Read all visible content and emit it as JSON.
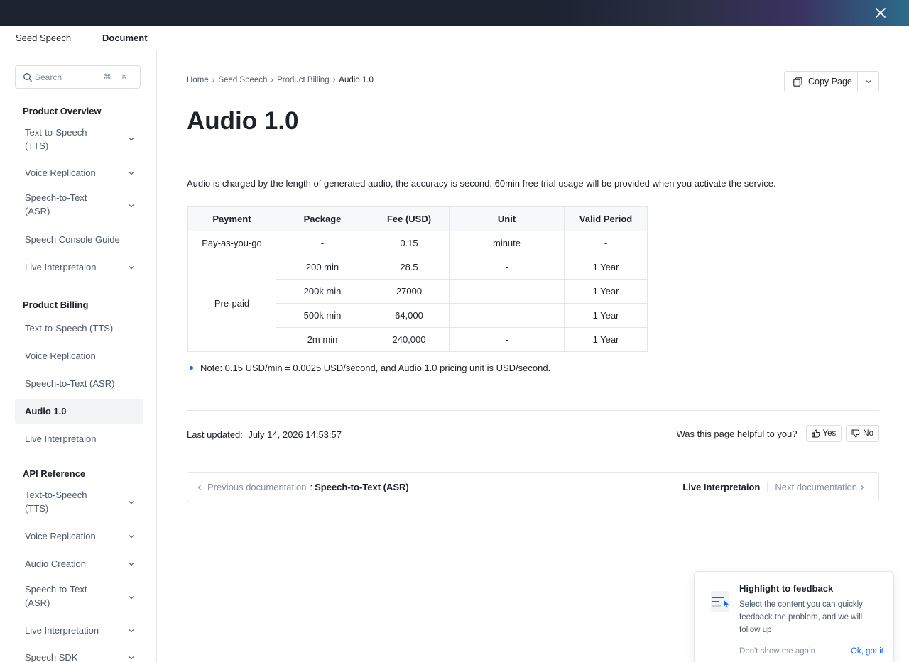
{
  "header": {
    "brand": "Seed Speech",
    "section": "Document"
  },
  "search": {
    "placeholder": "Search",
    "shortcut": "⌘ K"
  },
  "sidebar": {
    "groups": [
      {
        "title": "Product Overview",
        "items": [
          {
            "label": "Text-to-Speech (TTS)",
            "expandable": true
          },
          {
            "label": "Voice Replication",
            "expandable": true
          },
          {
            "label": "Speech-to-Text (ASR)",
            "expandable": true
          },
          {
            "label": "Speech Console Guide",
            "expandable": false
          },
          {
            "label": "Live Interpretaion",
            "expandable": true
          }
        ]
      },
      {
        "title": "Product Billing",
        "items": [
          {
            "label": "Text-to-Speech (TTS)",
            "expandable": false
          },
          {
            "label": "Voice Replication",
            "expandable": false
          },
          {
            "label": "Speech-to-Text (ASR)",
            "expandable": false
          },
          {
            "label": "Audio 1.0",
            "expandable": false,
            "active": true
          },
          {
            "label": "Live Interpretaion",
            "expandable": false
          }
        ]
      },
      {
        "title": "API Reference",
        "items": [
          {
            "label": "Text-to-Speech (TTS)",
            "expandable": true
          },
          {
            "label": "Voice Replication",
            "expandable": true
          },
          {
            "label": "Audio Creation",
            "expandable": true
          },
          {
            "label": "Speech-to-Text (ASR)",
            "expandable": true
          },
          {
            "label": "Live Interpretation",
            "expandable": true
          },
          {
            "label": "Speech SDK",
            "expandable": true
          }
        ]
      }
    ]
  },
  "breadcrumb": [
    "Home",
    "Seed Speech",
    "Product Billing",
    "Audio 1.0"
  ],
  "copy_page": {
    "label": "Copy Page"
  },
  "page": {
    "title": "Audio 1.0",
    "intro": "Audio is charged by the length of generated audio, the accuracy is second. 60min free trial usage will be provided when you activate the service.",
    "note": "Note: 0.15 USD/min = 0.0025 USD/second, and Audio 1.0 pricing unit is USD/second."
  },
  "table": {
    "headers": [
      "Payment",
      "Package",
      "Fee (USD)",
      "Unit",
      "Valid Period"
    ],
    "payg": {
      "payment": "Pay-as-you-go",
      "package": "-",
      "fee": "0.15",
      "unit": "minute",
      "period": "-"
    },
    "prepaid_label": "Pre-paid",
    "prepaid_rows": [
      {
        "package": "200 min",
        "fee": "28.5",
        "unit": "-",
        "period": "1 Year"
      },
      {
        "package": "200k min",
        "fee": "27000",
        "unit": "-",
        "period": "1 Year"
      },
      {
        "package": "500k min",
        "fee": "64,000",
        "unit": "-",
        "period": "1 Year"
      },
      {
        "package": "2m min",
        "fee": "240,000",
        "unit": "-",
        "period": "1 Year"
      }
    ]
  },
  "footer": {
    "last_updated_label": "Last updated:",
    "last_updated_value": "July 14, 2026 14:53:57",
    "helpful_question": "Was this page helpful to you?",
    "yes": "Yes",
    "no": "No"
  },
  "pager": {
    "prev_label": "Previous documentation",
    "prev_title": "Speech-to-Text (ASR)",
    "next_title": "Live Interpretaion",
    "next_label": "Next documentation"
  },
  "toast": {
    "title": "Highlight to feedback",
    "body": "Select the content you can quickly feedback the problem, and we will follow up",
    "dismiss": "Don't show me again",
    "confirm": "Ok, got it"
  },
  "colors": {
    "accent": "#1664ff",
    "topbar": "#1c2230",
    "active_bg": "#f2f3f5"
  }
}
